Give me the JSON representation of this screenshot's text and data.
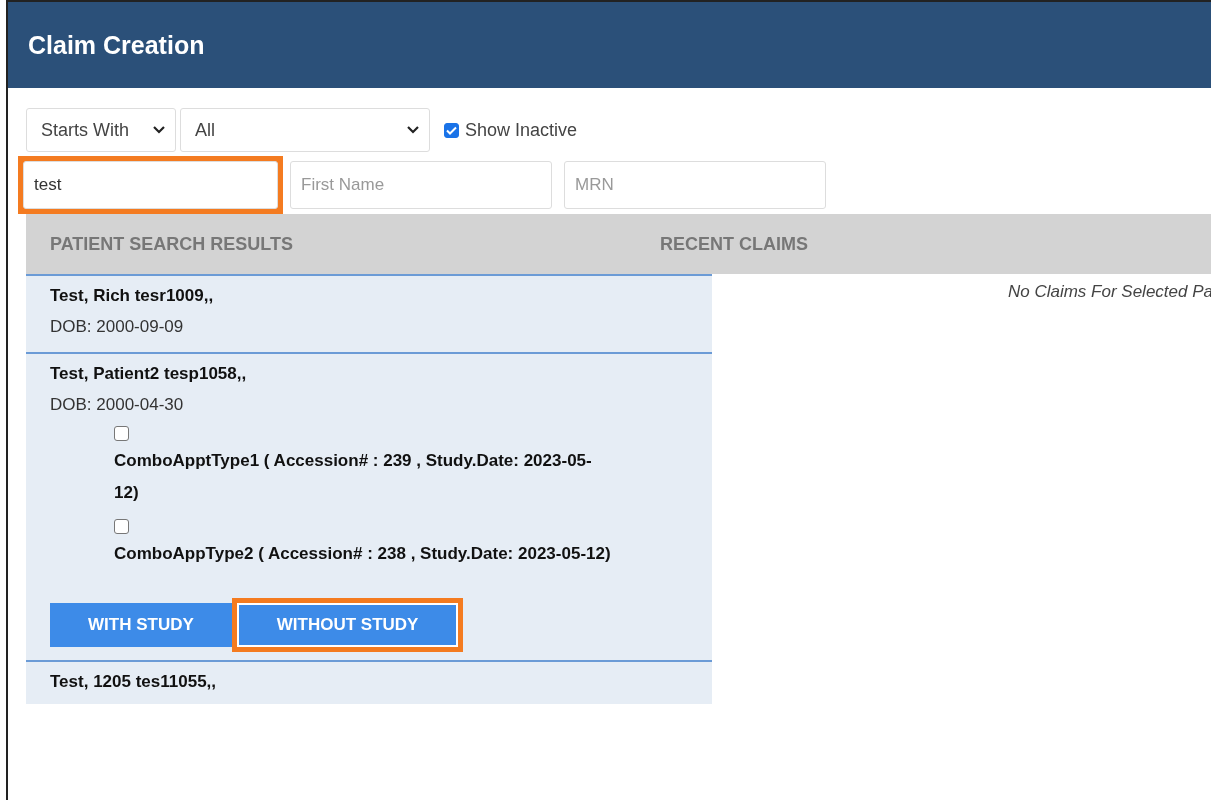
{
  "header": {
    "title": "Claim Creation"
  },
  "filters": {
    "match_select": {
      "value": "Starts With"
    },
    "status_select": {
      "value": "All"
    },
    "show_inactive": {
      "label": "Show Inactive",
      "checked": true
    }
  },
  "search_fields": [
    {
      "value": "test",
      "highlighted": true
    },
    {
      "placeholder": "First Name",
      "highlighted": false
    },
    {
      "placeholder": "MRN",
      "highlighted": false
    }
  ],
  "columns": [
    "PATIENT SEARCH RESULTS",
    "RECENT CLAIMS"
  ],
  "patients": [
    {
      "name": "Test, Rich  tesr1009,,",
      "dob": "DOB: 2000-09-09",
      "expanded": false
    },
    {
      "name": "Test, Patient2  tesp1058,,",
      "dob": "DOB: 2000-04-30",
      "expanded": true,
      "studies": [
        {
          "label": "ComboApptType1 ( Accession# : 239 , Study.Date: 2023-05-12)",
          "checked": false
        },
        {
          "label": "ComboAppType2 ( Accession# : 238 , Study.Date: 2023-05-12)",
          "checked": false
        }
      ],
      "buttons": [
        {
          "label": "WITH STUDY",
          "highlighted": false
        },
        {
          "label": "WITHOUT STUDY",
          "highlighted": true
        }
      ]
    },
    {
      "name": "Test, 1205  tes11055,,",
      "expanded": false
    }
  ],
  "recent_claims": {
    "message": "No Claims For Selected Pa"
  }
}
